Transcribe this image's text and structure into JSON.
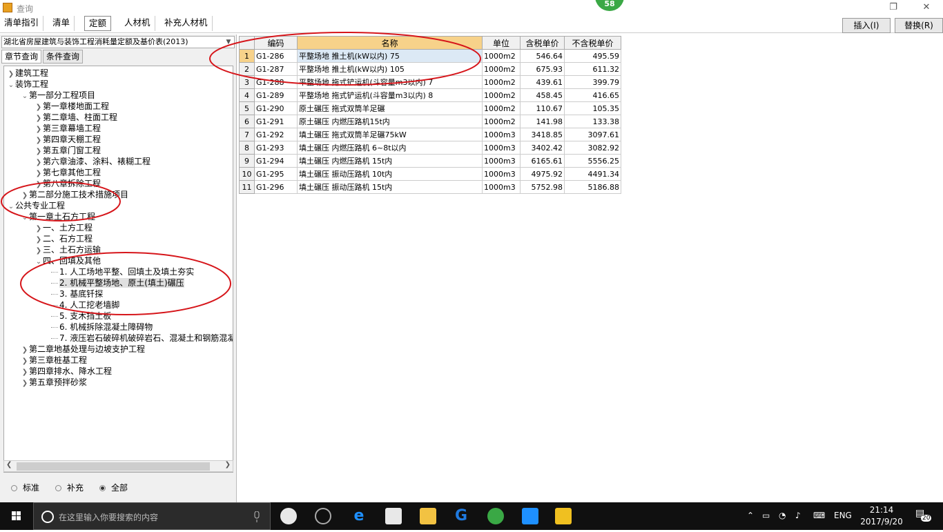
{
  "window": {
    "title": "查询",
    "badge": "58"
  },
  "tabs": [
    {
      "label": "清单指引"
    },
    {
      "label": "清单"
    },
    {
      "label": "定额"
    },
    {
      "label": "人材机"
    },
    {
      "label": "补充人材机"
    }
  ],
  "buttons": {
    "insert": "插入(I)",
    "replace": "替换(R)"
  },
  "left": {
    "dropdown": "湖北省房屋建筑与装饰工程消耗量定额及基价表(2013)",
    "tab_chapter": "章节查询",
    "tab_condition": "条件查询",
    "tree": [
      {
        "label": "建筑工程"
      },
      {
        "label": "装饰工程"
      },
      {
        "label": "第一部分工程项目"
      },
      {
        "label": "第一章楼地面工程"
      },
      {
        "label": "第二章墙、柱面工程"
      },
      {
        "label": "第三章幕墙工程"
      },
      {
        "label": "第四章天棚工程"
      },
      {
        "label": "第五章门窗工程"
      },
      {
        "label": "第六章油漆、涂料、裱糊工程"
      },
      {
        "label": "第七章其他工程"
      },
      {
        "label": "第八章拆除工程"
      },
      {
        "label": "第二部分施工技术措施项目"
      },
      {
        "label": "公共专业工程"
      },
      {
        "label": "第一章土石方工程"
      },
      {
        "label": "一、土方工程"
      },
      {
        "label": "二、石方工程"
      },
      {
        "label": "三、土石方运输"
      },
      {
        "label": "四、回填及其他"
      },
      {
        "label": "1. 人工场地平整、回填土及填土夯实"
      },
      {
        "label": "2. 机械平整场地、原土(填土)碾压"
      },
      {
        "label": "3. 基底钎探"
      },
      {
        "label": "4. 人工挖老墙脚"
      },
      {
        "label": "5. 支木挡土板"
      },
      {
        "label": "6. 机械拆除混凝土障碍物"
      },
      {
        "label": "7. 液压岩石破碎机破碎岩石、混凝土和钢筋混凝"
      },
      {
        "label": "第二章地基处理与边坡支护工程"
      },
      {
        "label": "第三章桩基工程"
      },
      {
        "label": "第四章排水、降水工程"
      },
      {
        "label": "第五章预拌砂浆"
      }
    ],
    "radios": {
      "standard": "标准",
      "supplement": "补充",
      "all": "全部",
      "selected": "all"
    }
  },
  "grid": {
    "headers": [
      "编码",
      "名称",
      "单位",
      "含税单价",
      "不含税单价"
    ],
    "rows": [
      {
        "idx": "1",
        "code": "G1-286",
        "name": "平整场地 推土机(kW以内) 75",
        "unit": "1000m2",
        "tax": "546.64",
        "notax": "495.59"
      },
      {
        "idx": "2",
        "code": "G1-287",
        "name": "平整场地 推土机(kW以内) 105",
        "unit": "1000m2",
        "tax": "675.93",
        "notax": "611.32"
      },
      {
        "idx": "3",
        "code": "G1-288",
        "name": "平整场地 拖式铲运机(斗容量m3以内) 7",
        "unit": "1000m2",
        "tax": "439.61",
        "notax": "399.79"
      },
      {
        "idx": "4",
        "code": "G1-289",
        "name": "平整场地 拖式铲运机(斗容量m3以内) 8",
        "unit": "1000m2",
        "tax": "458.45",
        "notax": "416.65"
      },
      {
        "idx": "5",
        "code": "G1-290",
        "name": "原土碾压 拖式双筒羊足碾",
        "unit": "1000m2",
        "tax": "110.67",
        "notax": "105.35"
      },
      {
        "idx": "6",
        "code": "G1-291",
        "name": "原土碾压 内燃压路机15t内",
        "unit": "1000m2",
        "tax": "141.98",
        "notax": "133.38"
      },
      {
        "idx": "7",
        "code": "G1-292",
        "name": "填土碾压 拖式双筒羊足碾75kW",
        "unit": "1000m3",
        "tax": "3418.85",
        "notax": "3097.61"
      },
      {
        "idx": "8",
        "code": "G1-293",
        "name": "填土碾压 内燃压路机 6~8t以内",
        "unit": "1000m3",
        "tax": "3402.42",
        "notax": "3082.92"
      },
      {
        "idx": "9",
        "code": "G1-294",
        "name": "填土碾压 内燃压路机 15t内",
        "unit": "1000m3",
        "tax": "6165.61",
        "notax": "5556.25"
      },
      {
        "idx": "10",
        "code": "G1-295",
        "name": "填土碾压 振动压路机 10t内",
        "unit": "1000m3",
        "tax": "4975.92",
        "notax": "4491.34"
      },
      {
        "idx": "11",
        "code": "G1-296",
        "name": "填土碾压 振动压路机 15t内",
        "unit": "1000m3",
        "tax": "5752.98",
        "notax": "5186.88"
      }
    ]
  },
  "taskbar": {
    "search_placeholder": "在这里输入你要搜索的内容",
    "lang": "ENG",
    "time": "21:14",
    "date": "2017/9/20",
    "notifications": "20"
  },
  "colors": {
    "annotation": "#d6151a",
    "header_highlight": "#f7d28a",
    "badge": "#3aa845"
  }
}
